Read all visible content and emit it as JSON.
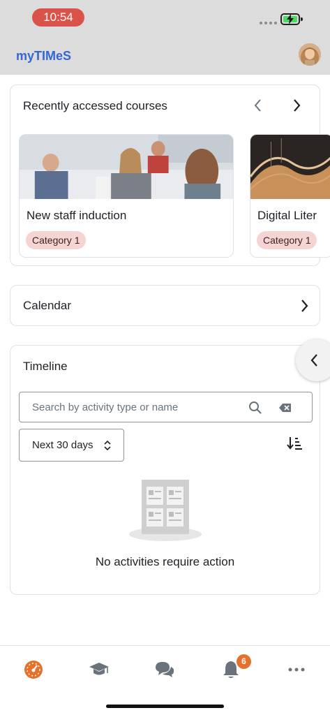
{
  "status_bar": {
    "time": "10:54"
  },
  "app": {
    "title": "myTIMeS"
  },
  "recent_courses": {
    "title": "Recently accessed courses",
    "courses": [
      {
        "name": "New staff induction",
        "category": "Category 1"
      },
      {
        "name": "Digital Liter",
        "category": "Category 1"
      }
    ]
  },
  "calendar": {
    "title": "Calendar"
  },
  "timeline": {
    "title": "Timeline",
    "search_placeholder": "Search by activity type or name",
    "filter_value": "Next 30 days",
    "empty_message": "No activities require action"
  },
  "bottom_nav": {
    "items": [
      "dashboard-icon",
      "courses-icon",
      "messages-icon",
      "notifications-icon",
      "more-icon"
    ],
    "notification_count": "6",
    "active_color": "#e5722a"
  },
  "colors": {
    "title_blue": "#3566d6",
    "badge_bg": "#f6d4d4",
    "accent_orange": "#e5722a"
  }
}
